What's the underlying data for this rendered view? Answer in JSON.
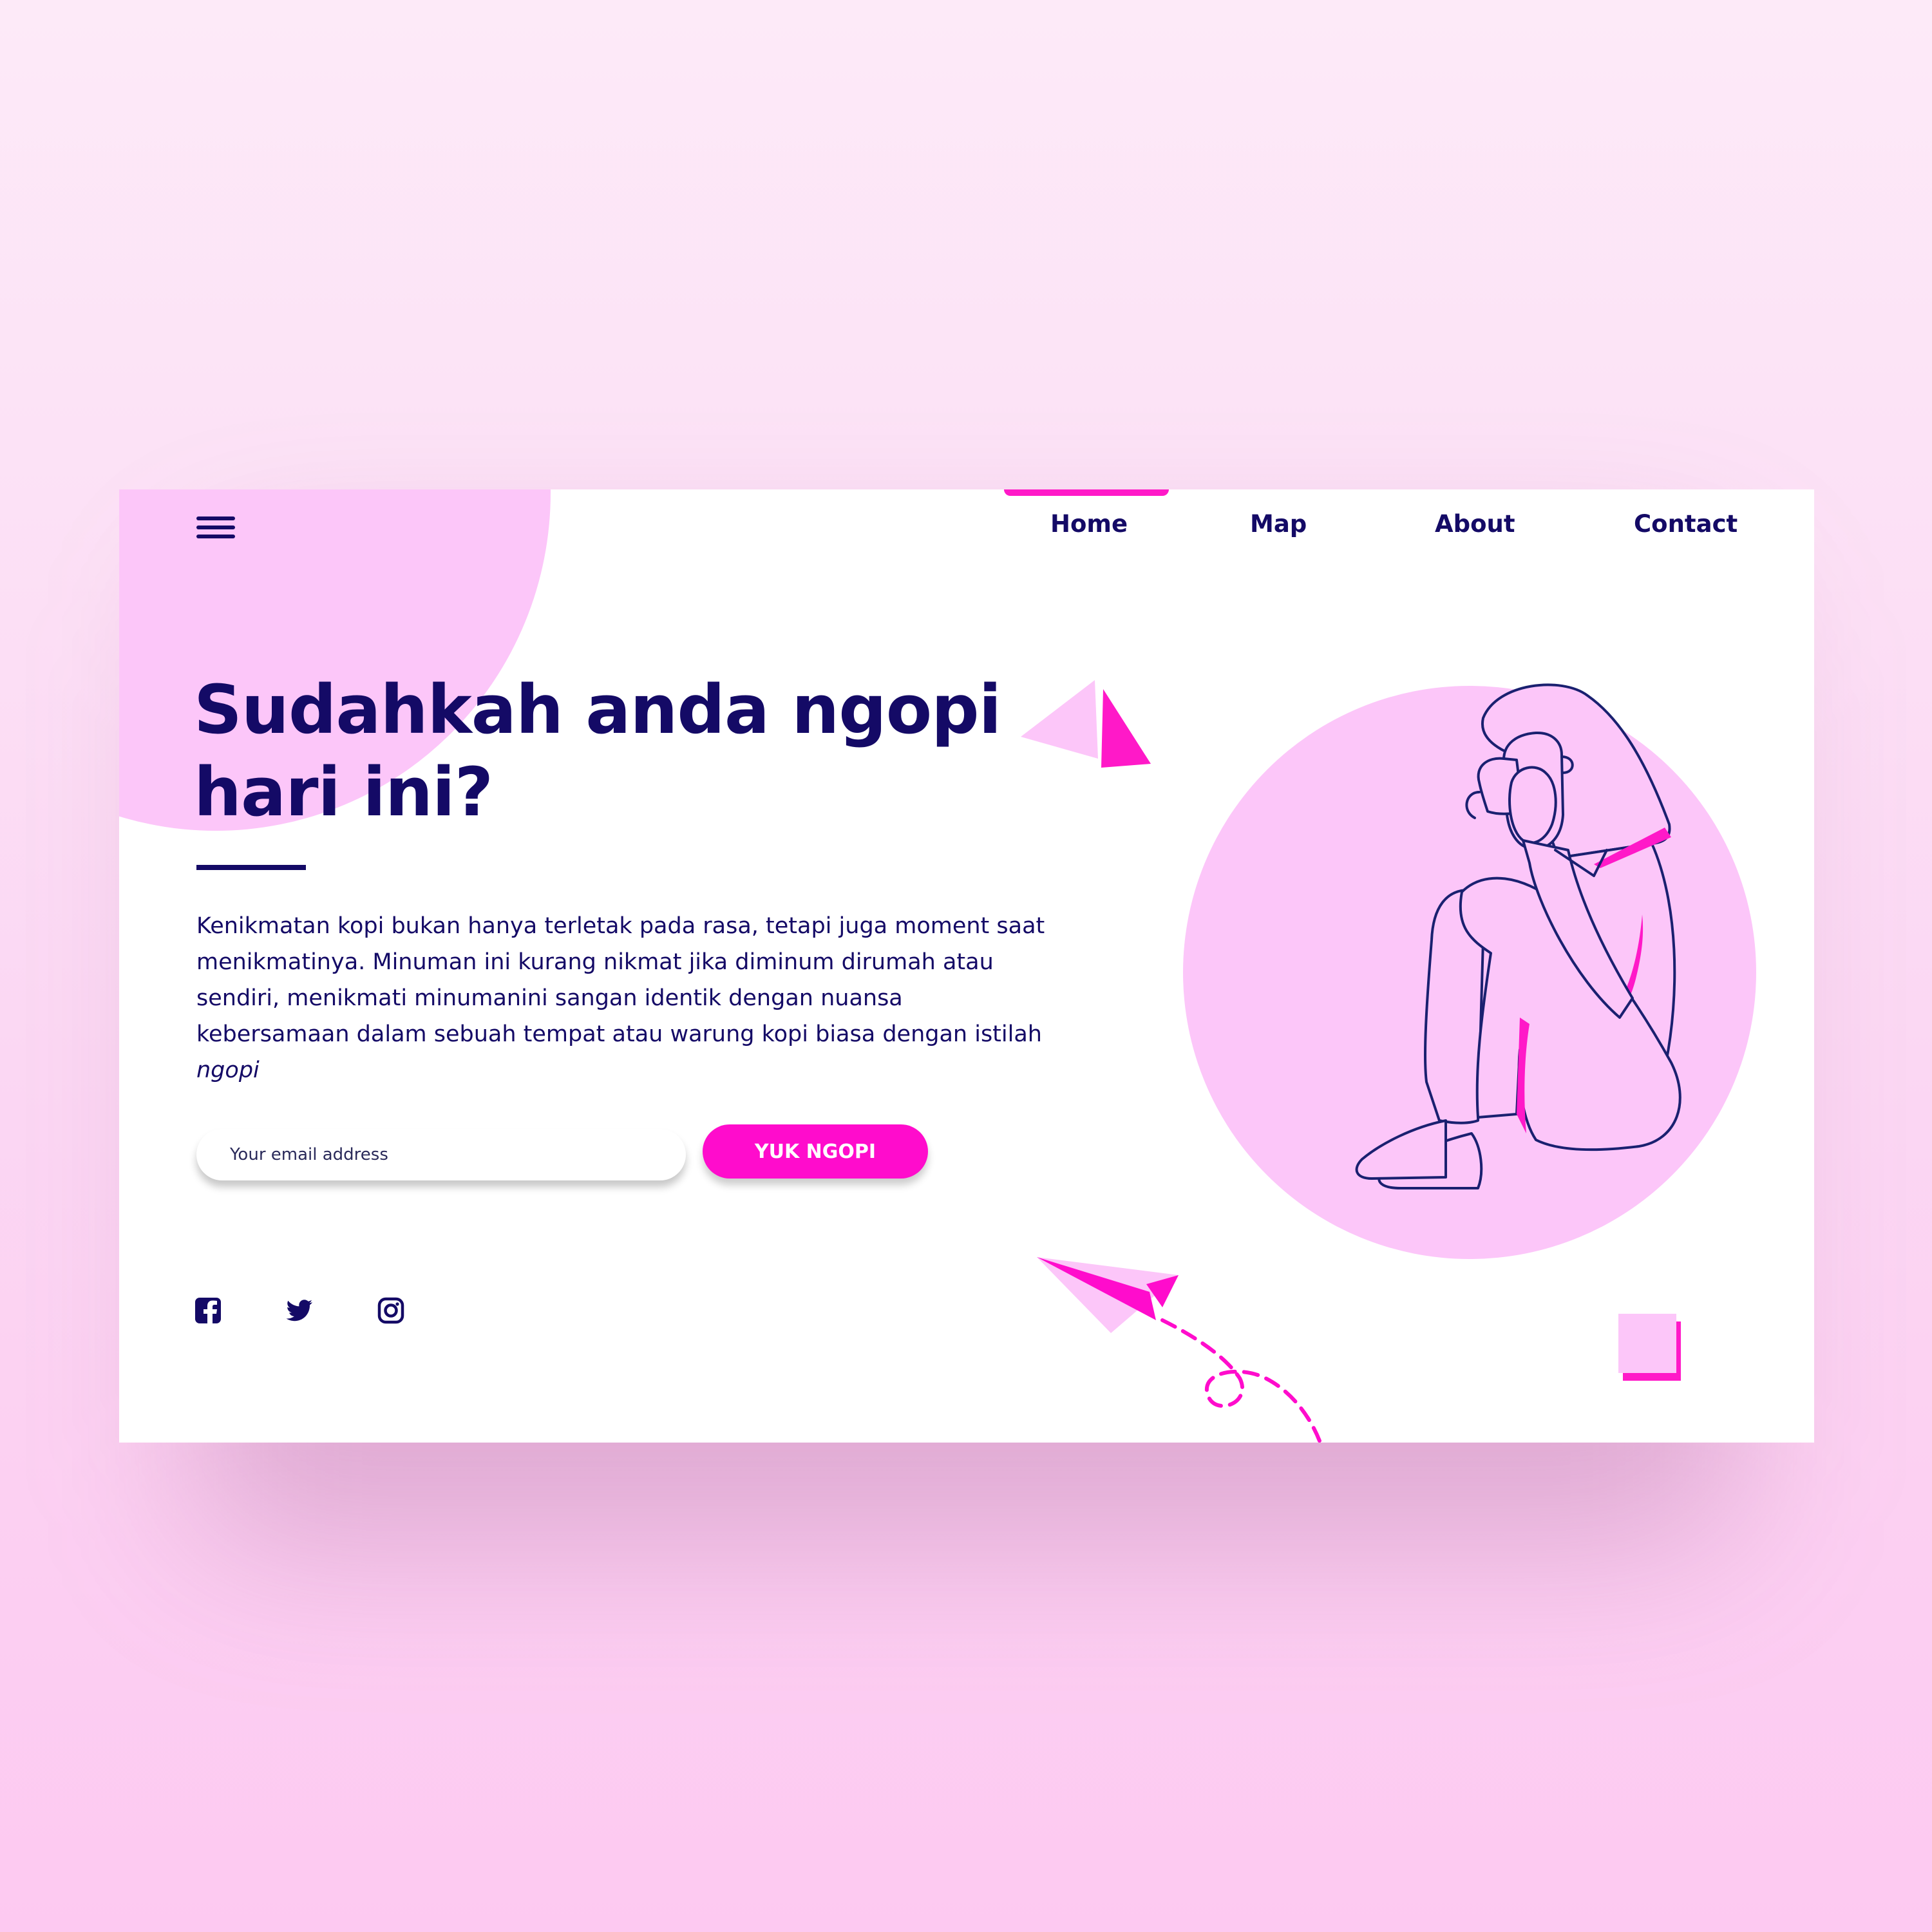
{
  "nav": {
    "items": [
      {
        "label": "Home",
        "active": true
      },
      {
        "label": "Map"
      },
      {
        "label": "About"
      },
      {
        "label": "Contact"
      }
    ]
  },
  "hero": {
    "headline_line1": "Sudahkah anda ngopi",
    "headline_line2": "hari ini?",
    "body": "Kenikmatan kopi bukan hanya terletak pada rasa, tetapi juga moment saat menikmatinya. Minuman ini kurang nikmat jika diminum dirumah atau sendiri, menikmati minumanini sangan identik dengan nuansa kebersamaan dalam sebuah tempat atau warung kopi biasa dengan istilah",
    "body_italic": "ngopi"
  },
  "form": {
    "email_placeholder": "Your email address",
    "button_label": "YUK NGOPI"
  },
  "social": {
    "icons": [
      "facebook-icon",
      "twitter-icon",
      "instagram-icon"
    ]
  },
  "colors": {
    "primary": "#140a66",
    "accent": "#ff0ccc",
    "light_pink": "#fcc6f9",
    "background": "#fbd7f3"
  }
}
